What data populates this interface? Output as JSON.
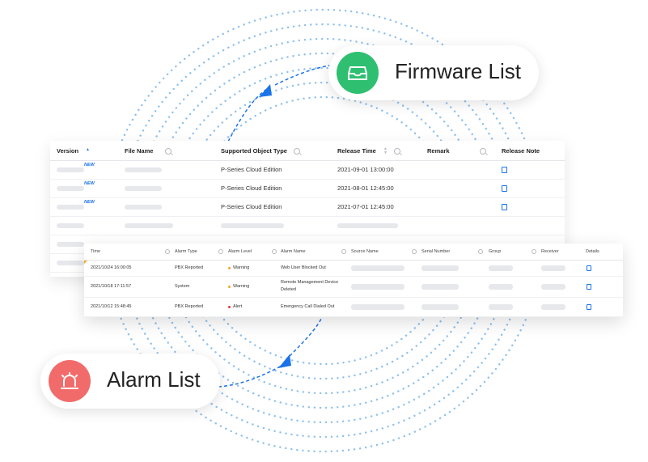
{
  "colors": {
    "accent_blue": "#1a73e8",
    "dotted_ring": "#8ec1ee",
    "firmware_icon_bg": "#2fbf71",
    "alarm_icon_bg": "#f26b6b",
    "warning_dot": "#f5a623",
    "alert_dot": "#e53935"
  },
  "firmware_pill": {
    "label": "Firmware List",
    "icon": "inbox-tray-icon"
  },
  "alarm_pill": {
    "label": "Alarm List",
    "icon": "siren-alarm-icon"
  },
  "firmware_table": {
    "headers": {
      "version": "Version",
      "file_name": "File Name",
      "supported": "Supported Object Type",
      "release_time": "Release Time",
      "remark": "Remark",
      "release_note": "Release Note"
    },
    "new_badge": "NEW",
    "rows": [
      {
        "supported": "P-Series Cloud Edition",
        "release_time": "2021-09-01 13:00:00"
      },
      {
        "supported": "P-Series Cloud Edition",
        "release_time": "2021-08-01 12:45:00"
      },
      {
        "supported": "P-Series Cloud Edition",
        "release_time": "2021-07-01 12:45:00"
      }
    ]
  },
  "alarm_table": {
    "headers": {
      "time": "Time",
      "alarm_type": "Alarm Type",
      "alarm_level": "Alarm Level",
      "alarm_name": "Alarm Name",
      "source_name": "Source Name",
      "serial_number": "Serial Number",
      "group": "Group",
      "receiver": "Receiver",
      "details": "Details"
    },
    "rows": [
      {
        "time": "2021/10/24 16:00:05",
        "type": "PBX Reported",
        "level": "Warning",
        "name": "Web User Blocked Out"
      },
      {
        "time": "2021/10/18 17:11:57",
        "type": "System",
        "level": "Warning",
        "name_line1": "Remote Management Device",
        "name_line2": "Deleted"
      },
      {
        "time": "2021/10/12 15:48:45",
        "type": "PBX Reported",
        "level": "Alert",
        "name": "Emergency Call Dialed Out"
      }
    ]
  }
}
